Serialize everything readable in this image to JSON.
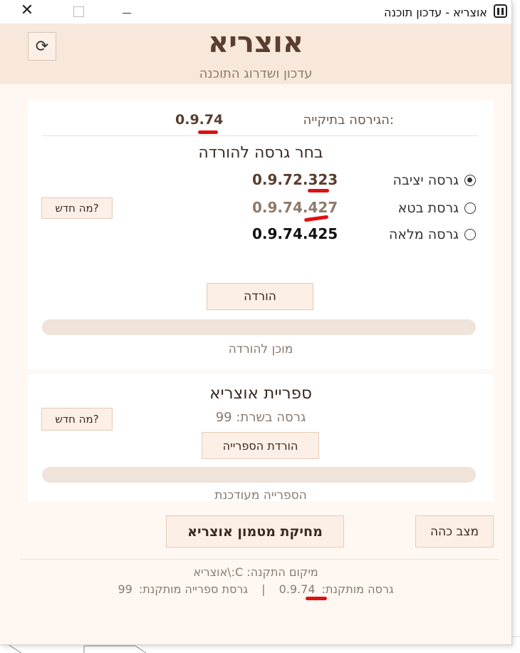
{
  "window": {
    "title": "אוצריא - עדכון תוכנה"
  },
  "header": {
    "app_name": "אוצריא",
    "subtitle": "עדכון ושדרוג התוכנה",
    "refresh_icon": "⟳"
  },
  "update": {
    "current_label": "הגירסה בתיקייה:",
    "current_version": "0.9.74",
    "choose_title": "בחר גרסה להורדה",
    "options": [
      {
        "label": "גרסה יציבה",
        "version": "0.9.72.323",
        "selected": true
      },
      {
        "label": "גרסת בטא",
        "version": "0.9.74.427",
        "selected": false
      },
      {
        "label": "גרסה מלאה",
        "version": "0.9.74.425",
        "selected": false
      }
    ],
    "whats_new": "מה חדש?",
    "download": "הורדה",
    "progress": 0,
    "status": "מוכן להורדה"
  },
  "library": {
    "title": "ספריית אוצריא",
    "server_version": "גרסה בשרת: 99",
    "whats_new": "מה חדש?",
    "download": "הורדת הספרייה",
    "progress": 0,
    "status": "הספרייה מעודכנת"
  },
  "actions": {
    "clear_cache": "מחיקת מטמון אוצריא",
    "dark_mode": "מצב כהה"
  },
  "footer": {
    "install_path": "מיקום התקנה: C:\\אוצריא",
    "installed_version_label": "גרסה מותקנת:",
    "installed_version": "0.9.74",
    "separator": "|",
    "library_version_label": "גרסת ספרייה מותקנת:",
    "library_version": "99"
  },
  "colors": {
    "accent": "#5a3e30",
    "header_bg": "#f8e8db",
    "annotation": "#e01010"
  }
}
